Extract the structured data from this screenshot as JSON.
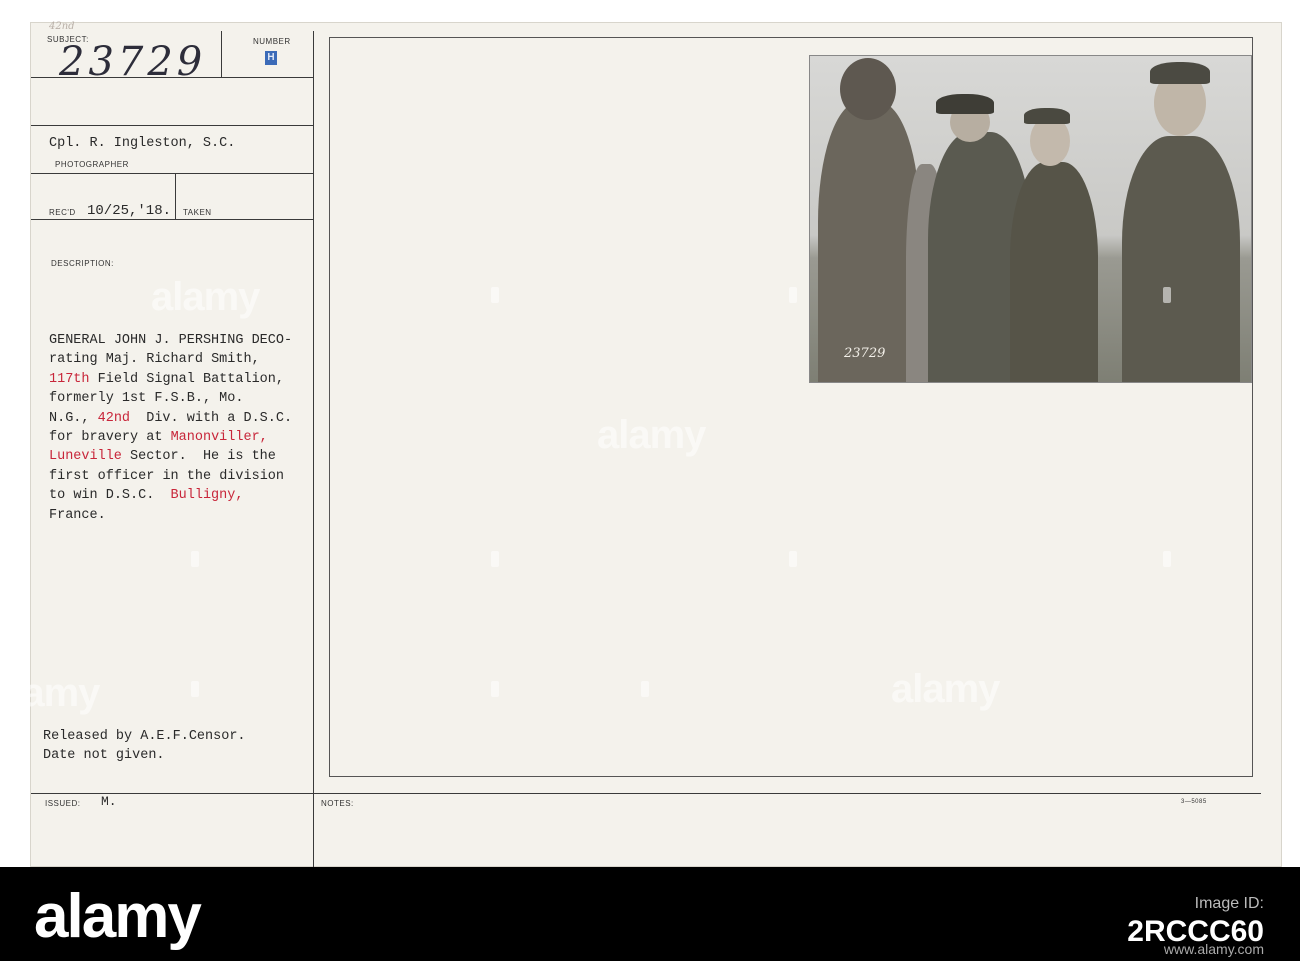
{
  "card": {
    "faint_annotation": "42nd",
    "subject_label": "SUBJECT:",
    "subject_number_handwritten": "23729",
    "number_label": "NUMBER",
    "number_stamp": "H",
    "photographer_name": "Cpl. R. Ingleston, S.C.",
    "photographer_label": "PHOTOGRAPHER",
    "recd_label": "REC'D",
    "recd_date": "10/25,'18.",
    "taken_label": "TAKEN",
    "description_label": "DESCRIPTION:",
    "description_lines": [
      "GENERAL JOHN J. PERSHING DECO-",
      "rating Maj. Richard Smith,",
      "117th Field Signal Battalion,",
      "formerly 1st F.S.B., Mo.",
      "N.G., 42nd  Div. with a D.S.C.",
      "for bravery at Manonviller,",
      "Luneville Sector.  He is the",
      "first officer in the division",
      "to win D.S.C.  Bulligny,",
      "France."
    ],
    "highlight_tokens": [
      "117th",
      "42nd",
      "Manonviller,",
      "Luneville",
      "Bulligny,"
    ],
    "released_lines": [
      "Released by A.E.F.Censor.",
      "Date not given."
    ],
    "issued_label": "ISSUED:",
    "issued_value": "M.",
    "notes_label": "NOTES:",
    "form_code": "3—5085",
    "photo_number": "23729"
  },
  "watermark": {
    "text": "alamy"
  },
  "footer": {
    "logo": "alamy",
    "image_id_label": "Image ID:",
    "image_id": "2RCCC60",
    "url": "www.alamy.com"
  },
  "colors": {
    "card_bg": "#f4f2ec",
    "ink": "#2a2a2a",
    "red_ink": "#c8263a",
    "footer_bg": "#000000"
  }
}
